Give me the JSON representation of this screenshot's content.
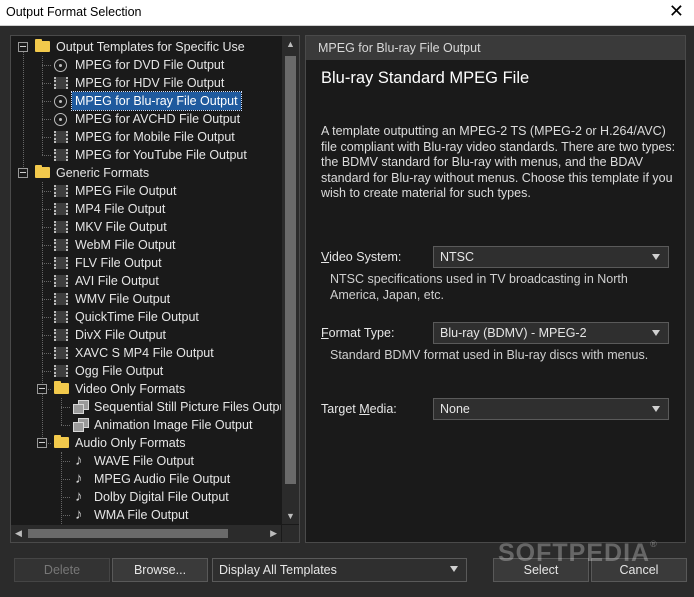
{
  "window": {
    "title": "Output Format Selection",
    "close_glyph": "✕"
  },
  "tree": {
    "items": [
      {
        "label": "Output Templates for Specific Use",
        "icon": "folder-icon"
      },
      {
        "label": "MPEG for DVD File Output",
        "icon": "disc-icon"
      },
      {
        "label": "MPEG for HDV File Output",
        "icon": "film-icon"
      },
      {
        "label": "MPEG for Blu-ray File Output",
        "icon": "disc-icon",
        "selected": true
      },
      {
        "label": "MPEG for AVCHD File Output",
        "icon": "disc-icon"
      },
      {
        "label": "MPEG for Mobile File Output",
        "icon": "film-icon"
      },
      {
        "label": "MPEG for YouTube File Output",
        "icon": "film-icon"
      },
      {
        "label": "Generic Formats",
        "icon": "folder-icon"
      },
      {
        "label": "MPEG File Output",
        "icon": "film-icon"
      },
      {
        "label": "MP4 File Output",
        "icon": "film-icon"
      },
      {
        "label": "MKV File Output",
        "icon": "film-icon"
      },
      {
        "label": "WebM File Output",
        "icon": "film-icon"
      },
      {
        "label": "FLV File Output",
        "icon": "film-icon"
      },
      {
        "label": "AVI File Output",
        "icon": "film-icon"
      },
      {
        "label": "WMV File Output",
        "icon": "film-icon"
      },
      {
        "label": "QuickTime File Output",
        "icon": "film-icon"
      },
      {
        "label": "DivX File Output",
        "icon": "film-icon"
      },
      {
        "label": "XAVC S MP4 File Output",
        "icon": "film-icon"
      },
      {
        "label": "Ogg File Output",
        "icon": "film-icon"
      },
      {
        "label": "Video Only Formats",
        "icon": "folder-icon"
      },
      {
        "label": "Sequential Still Picture Files Outpu",
        "icon": "image-stack-icon"
      },
      {
        "label": "Animation Image File Output",
        "icon": "image-stack-icon"
      },
      {
        "label": "Audio Only Formats",
        "icon": "folder-icon"
      },
      {
        "label": "WAVE File Output",
        "icon": "music-note-icon"
      },
      {
        "label": "MPEG Audio File Output",
        "icon": "music-note-icon"
      },
      {
        "label": "Dolby Digital File Output",
        "icon": "music-note-icon"
      },
      {
        "label": "WMA File Output",
        "icon": "music-note-icon"
      }
    ]
  },
  "panel": {
    "header": "MPEG for Blu-ray File Output",
    "title": "Blu-ray Standard MPEG File",
    "description": "A template outputting an MPEG-2 TS (MPEG-2 or H.264/AVC) file compliant with Blu-ray video standards. There are two types: the BDMV standard for Blu-ray with menus, and the BDAV standard for Blu-ray without menus. Choose this template if you wish to create material for such types.",
    "video_system": {
      "label_accel": "V",
      "label_rest": "ideo System:",
      "value": "NTSC",
      "help": "NTSC specifications used in TV broadcasting in North America, Japan, etc."
    },
    "format_type": {
      "label_accel": "F",
      "label_rest": "ormat Type:",
      "value": "Blu-ray (BDMV) - MPEG-2",
      "help": "Standard BDMV format used in Blu-ray discs with menus."
    },
    "target_media": {
      "label_pre": "Target ",
      "label_accel": "M",
      "label_rest": "edia:",
      "value": "None"
    }
  },
  "footer": {
    "delete_label": "Delete",
    "browse_label": "Browse...",
    "display_select": "Display All Templates",
    "select_label": "Select",
    "cancel_label": "Cancel"
  },
  "watermark": "SOFTPEDIA"
}
